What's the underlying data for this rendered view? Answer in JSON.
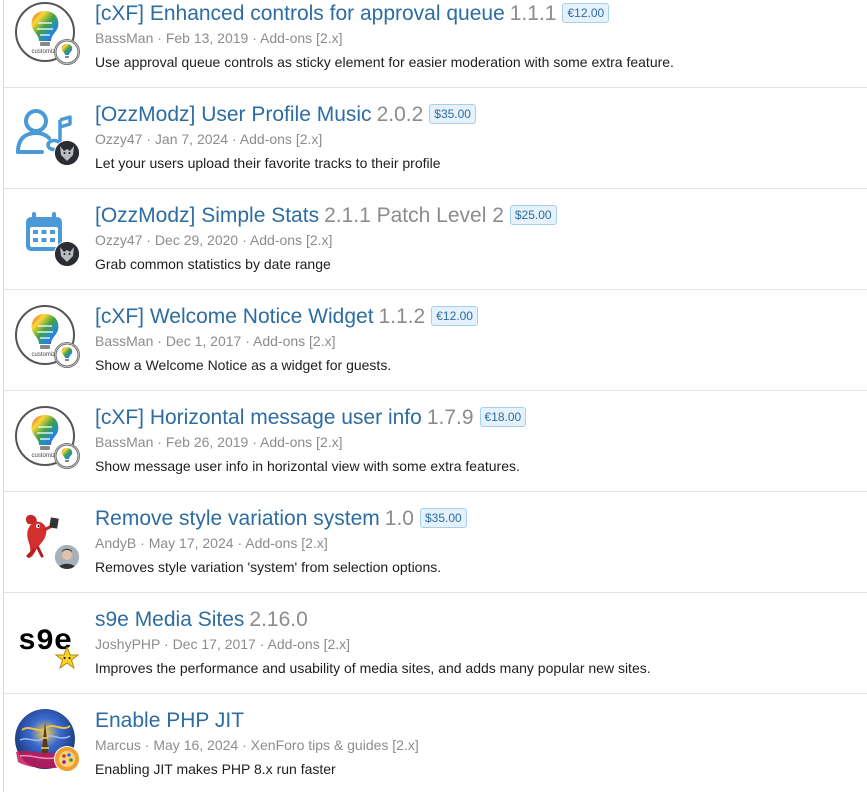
{
  "resources": [
    {
      "title": "[cXF] Enhanced controls for approval queue",
      "version": "1.1.1",
      "price": "€12.00",
      "author": "BassMan",
      "date": "Feb 13, 2019",
      "category": "Add-ons [2.x]",
      "description": "Use approval queue controls as sticky element for easier moderation with some extra feature.",
      "icon": "bulb-logo-icon",
      "logo_text": "customize"
    },
    {
      "title": "[OzzModz] User Profile Music",
      "version": "2.0.2",
      "price": "$35.00",
      "author": "Ozzy47",
      "date": "Jan 7, 2024",
      "category": "Add-ons [2.x]",
      "description": "Let your users upload their favorite tracks to their profile",
      "icon": "user-music-icon"
    },
    {
      "title": "[OzzModz] Simple Stats",
      "version": "2.1.1 Patch Level 2",
      "price": "$25.00",
      "author": "Ozzy47",
      "date": "Dec 29, 2020",
      "category": "Add-ons [2.x]",
      "description": "Grab common statistics by date range",
      "icon": "calendar-icon"
    },
    {
      "title": "[cXF] Welcome Notice Widget",
      "version": "1.1.2",
      "price": "€12.00",
      "author": "BassMan",
      "date": "Dec 1, 2017",
      "category": "Add-ons [2.x]",
      "description": "Show a Welcome Notice as a widget for guests.",
      "icon": "bulb-logo-icon",
      "logo_text": "customize"
    },
    {
      "title": "[cXF] Horizontal message user info",
      "version": "1.7.9",
      "price": "€18.00",
      "author": "BassMan",
      "date": "Feb 26, 2019",
      "category": "Add-ons [2.x]",
      "description": "Show message user info in horizontal view with some extra features.",
      "icon": "bulb-logo-icon",
      "logo_text": "customize"
    },
    {
      "title": "Remove style variation system",
      "version": "1.0",
      "price": "$35.00",
      "author": "AndyB",
      "date": "May 17, 2024",
      "category": "Add-ons [2.x]",
      "description": "Removes style variation 'system' from selection options.",
      "icon": "mascot-icon"
    },
    {
      "title": "s9e Media Sites",
      "version": "2.16.0",
      "price": "",
      "author": "JoshyPHP",
      "date": "Dec 17, 2017",
      "category": "Add-ons [2.x]",
      "description": "Improves the performance and usability of media sites, and adds many popular new sites.",
      "icon": "s9e-logo-icon",
      "logo_text": "s9e"
    },
    {
      "title": "Enable PHP JIT",
      "version": "",
      "price": "",
      "author": "Marcus",
      "date": "May 16, 2024",
      "category": "XenForo tips & guides [2.x]",
      "description": "Enabling JIT makes PHP 8.x run faster",
      "icon": "painting-icon"
    }
  ],
  "meta_separator": "·",
  "colors": {
    "link": "#2d6ca2",
    "muted": "#8c8c8c",
    "price_bg": "#e5f2fb",
    "price_border": "#a8cfe9",
    "icon_blue": "#4a9ad8"
  }
}
